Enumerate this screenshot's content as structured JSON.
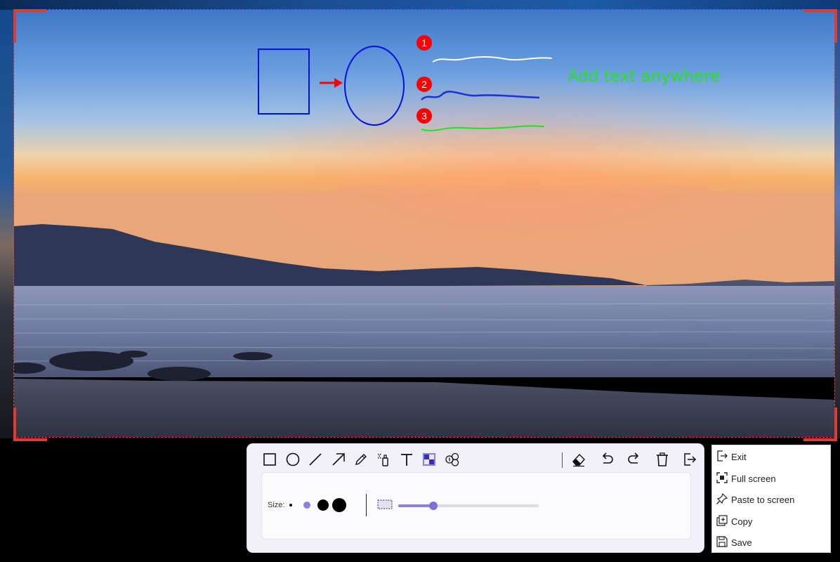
{
  "canvas": {
    "annotation_text": "Add text anywhere",
    "step_markers": [
      "1",
      "2",
      "3"
    ],
    "annotation_colors": {
      "marker": "#ff0000",
      "shapes": "#0000ff",
      "text": "#00dd00",
      "white_line": "#ffffff",
      "blue_line": "#1a2fe0",
      "green_line": "#22e022"
    },
    "selection_border_color": "#e23b2e"
  },
  "toolbar": {
    "tools": [
      {
        "name": "rectangle-tool-icon",
        "selected": false
      },
      {
        "name": "ellipse-tool-icon",
        "selected": false
      },
      {
        "name": "line-tool-icon",
        "selected": false
      },
      {
        "name": "arrow-tool-icon",
        "selected": false
      },
      {
        "name": "pencil-tool-icon",
        "selected": false
      },
      {
        "name": "highlighter-tool-icon",
        "selected": false
      },
      {
        "name": "text-tool-icon",
        "selected": false
      },
      {
        "name": "mosaic-tool-icon",
        "selected": true
      },
      {
        "name": "serial-number-tool-icon",
        "selected": false
      }
    ],
    "actions": [
      "eraser-icon",
      "undo-icon",
      "redo-icon",
      "trash-icon",
      "export-icon"
    ],
    "options": {
      "size_label": "Size:",
      "sizes": [
        "xs",
        "small",
        "medium",
        "large"
      ],
      "selected_size": "small",
      "mosaic_level": 0.25
    },
    "accent_color": "#7b6fdc"
  },
  "menu": {
    "items": [
      {
        "label": "Exit",
        "icon": "exit-icon"
      },
      {
        "label": "Full screen",
        "icon": "fullscreen-icon"
      },
      {
        "label": "Paste to screen",
        "icon": "pin-icon"
      },
      {
        "label": "Copy",
        "icon": "copy-icon"
      },
      {
        "label": "Save",
        "icon": "save-icon"
      }
    ]
  }
}
